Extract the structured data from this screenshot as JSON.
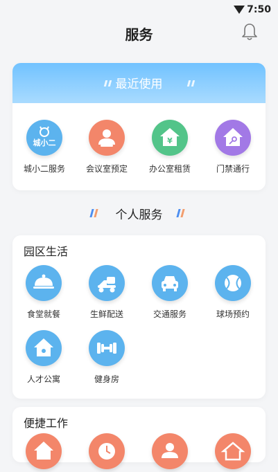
{
  "status_bar": {
    "time": "7:50"
  },
  "header": {
    "title": "服务"
  },
  "recent": {
    "title": "最近使用",
    "items": [
      {
        "label": "城小二服务",
        "icon": "chengxiaoer-logo-icon",
        "logo_text": "城小二"
      },
      {
        "label": "会议室预定",
        "icon": "meeting-room-icon"
      },
      {
        "label": "办公室租赁",
        "icon": "office-rent-icon"
      },
      {
        "label": "门禁通行",
        "icon": "access-control-icon"
      }
    ]
  },
  "personal": {
    "title": "个人服务"
  },
  "park_life": {
    "title": "园区生活",
    "items": [
      {
        "label": "食堂就餐",
        "icon": "canteen-icon"
      },
      {
        "label": "生鲜配送",
        "icon": "delivery-icon"
      },
      {
        "label": "交通服务",
        "icon": "car-icon"
      },
      {
        "label": "球场预约",
        "icon": "ball-icon"
      },
      {
        "label": "人才公寓",
        "icon": "apartment-icon"
      },
      {
        "label": "健身房",
        "icon": "dumbbell-icon"
      }
    ]
  },
  "quick_work": {
    "title": "便捷工作"
  },
  "colors": {
    "blue": "#5cb3ee",
    "orange": "#f3866a",
    "green": "#53c489",
    "purple": "#a279e6",
    "header_gradient_top": "#71c2ff"
  }
}
